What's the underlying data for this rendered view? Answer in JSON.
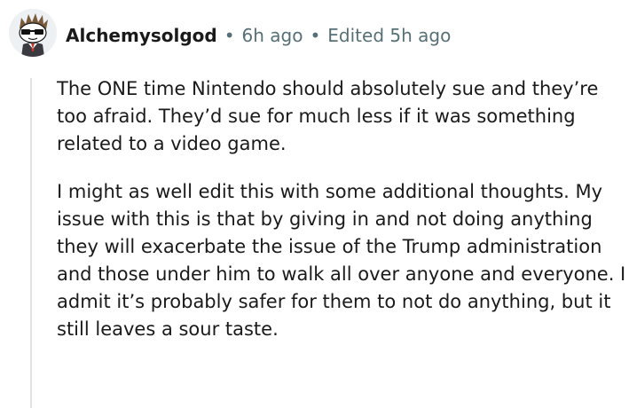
{
  "comment": {
    "author": "Alchemysolgod",
    "separator": "•",
    "posted": "6h ago",
    "edited": "Edited 5h ago",
    "avatar_icon": "snoo-avatar-with-sunglasses-icon",
    "paragraphs": [
      "The ONE time Nintendo should absolutely sue and they’re too afraid. They’d sue for much less if it was something related to a video game.",
      "I might as well edit this with some additional thoughts. My issue with this is that by giving in and not doing anything they will exacerbate the issue of the Trump administration and those under him to walk all over anyone and everyone. I admit it’s probably safer for them to not do anything, but it still leaves a sour taste."
    ]
  },
  "colors": {
    "text": "#1a1a1b",
    "meta": "#576f76",
    "thread_line": "#dfe3e6",
    "avatar_bg": "#eef1f3"
  }
}
